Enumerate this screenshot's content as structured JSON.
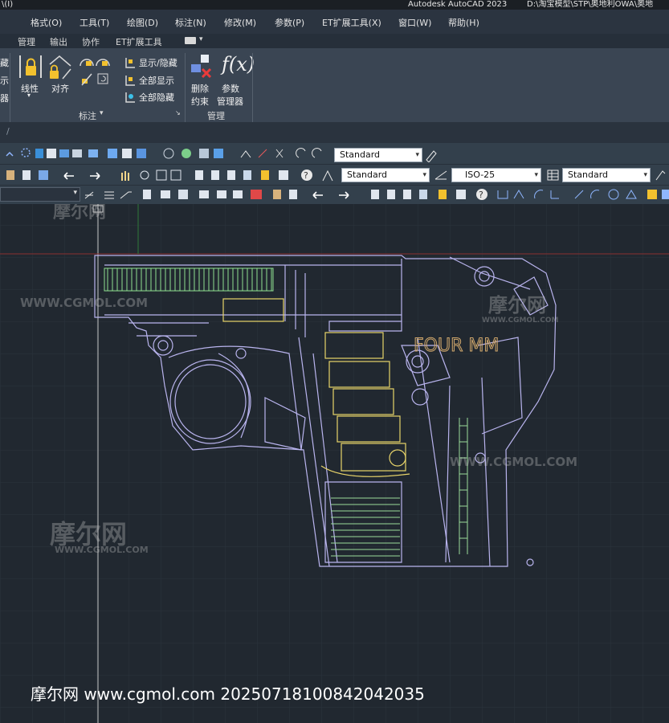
{
  "titlebar": {
    "left_fragment": "\\(I)",
    "app_title": "Autodesk AutoCAD 2023",
    "file_path": "D:\\淘宝模型\\STP\\奥地利OWA\\奥地"
  },
  "menubar": {
    "items": [
      "格式(O)",
      "工具(T)",
      "绘图(D)",
      "标注(N)",
      "修改(M)",
      "参数(P)",
      "ET扩展工具(X)",
      "窗口(W)",
      "帮助(H)"
    ]
  },
  "ribbon_tabs": {
    "items": [
      "管理",
      "输出",
      "协作",
      "ET扩展工具"
    ]
  },
  "ribbon": {
    "partial_left": [
      "藏",
      "示",
      "器"
    ],
    "linear_label": "线性",
    "align_label": "对齐",
    "show_hide_label": "显示/隐藏",
    "show_all_label": "全部显示",
    "hide_all_label": "全部隐藏",
    "delete_label_1": "删除",
    "delete_label_2": "约束",
    "param_label_1": "参数",
    "param_label_2": "管理器",
    "panel_dimension": "标注",
    "panel_manage": "管理",
    "fx_symbol": "f(x)"
  },
  "toolbars": {
    "text_style": "Standard",
    "multileader_style": "Standard",
    "dim_style": "ISO-25",
    "table_style": "Standard"
  },
  "drawing": {
    "gun_text": "FOUR MM",
    "watermarks": [
      "摩尔网",
      "WWW.CGMOL.COM",
      "摩尔网",
      "WWW.CGMOL.COM",
      "摩尔网",
      "WWW.CGMOL.COM",
      "WWW.CGMOL.COM"
    ],
    "footer": "摩尔网 www.cgmol.com 20250718100842042035"
  },
  "colors": {
    "background": "#212830",
    "ribbon": "#3a4553",
    "toolbar": "#33404c",
    "wire_main": "#b9b4ee",
    "wire_yellow": "#e8d46a",
    "wire_green": "#8fe08f"
  }
}
